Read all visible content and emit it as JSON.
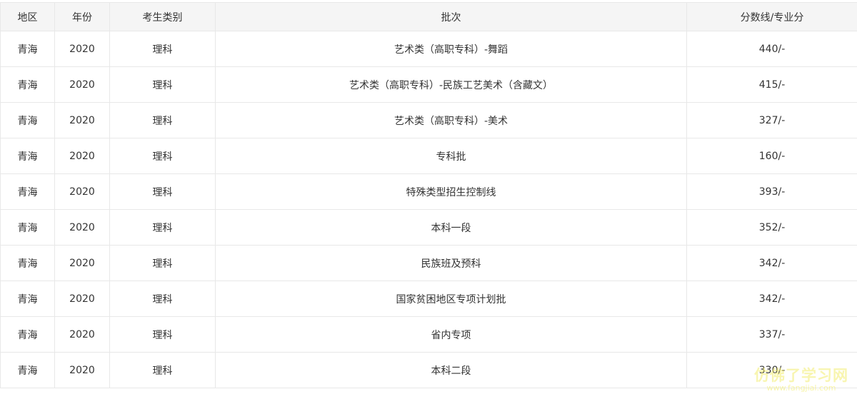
{
  "table": {
    "headers": [
      "地区",
      "年份",
      "考生类别",
      "批次",
      "分数线/专业分"
    ],
    "rows": [
      [
        "青海",
        "2020",
        "理科",
        "艺术类（高职专科）-舞蹈",
        "440/-"
      ],
      [
        "青海",
        "2020",
        "理科",
        "艺术类（高职专科）-民族工艺美术（含藏文）",
        "415/-"
      ],
      [
        "青海",
        "2020",
        "理科",
        "艺术类（高职专科）-美术",
        "327/-"
      ],
      [
        "青海",
        "2020",
        "理科",
        "专科批",
        "160/-"
      ],
      [
        "青海",
        "2020",
        "理科",
        "特殊类型招生控制线",
        "393/-"
      ],
      [
        "青海",
        "2020",
        "理科",
        "本科一段",
        "352/-"
      ],
      [
        "青海",
        "2020",
        "理科",
        "民族班及预科",
        "342/-"
      ],
      [
        "青海",
        "2020",
        "理科",
        "国家贫困地区专项计划批",
        "342/-"
      ],
      [
        "青海",
        "2020",
        "理科",
        "省内专项",
        "337/-"
      ],
      [
        "青海",
        "2020",
        "理科",
        "本科二段",
        "330/-"
      ]
    ]
  },
  "watermark": {
    "main": "仿佛了学习网",
    "sub": "www.fangjial.com"
  }
}
